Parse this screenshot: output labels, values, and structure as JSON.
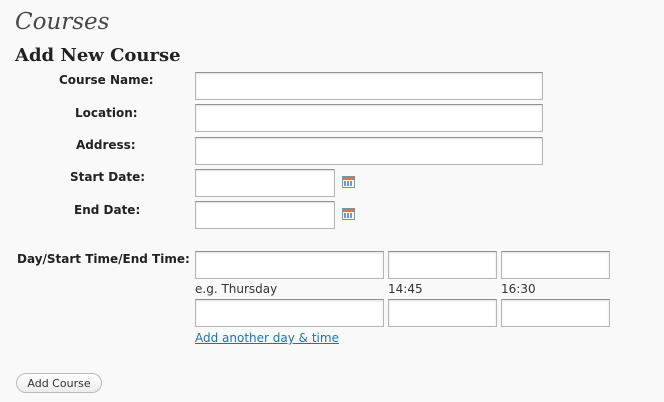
{
  "page": {
    "title": "Courses"
  },
  "form": {
    "heading": "Add New Course",
    "fields": {
      "course_name": {
        "label": "Course Name:",
        "value": ""
      },
      "location": {
        "label": "Location:",
        "value": ""
      },
      "address": {
        "label": "Address:",
        "value": ""
      },
      "start_date": {
        "label": "Start Date:",
        "value": ""
      },
      "end_date": {
        "label": "End Date:",
        "value": ""
      }
    },
    "calendar_icon": "calendar-icon",
    "schedule": {
      "label": "Day/Start Time/End Time:",
      "hints": {
        "day": "e.g. Thursday",
        "start_time": "14:45",
        "end_time": "16:30"
      },
      "rows": [
        {
          "day": "",
          "start_time": "",
          "end_time": ""
        },
        {
          "day": "",
          "start_time": "",
          "end_time": ""
        }
      ],
      "add_link": "Add another day & time"
    },
    "submit_label": "Add Course"
  }
}
